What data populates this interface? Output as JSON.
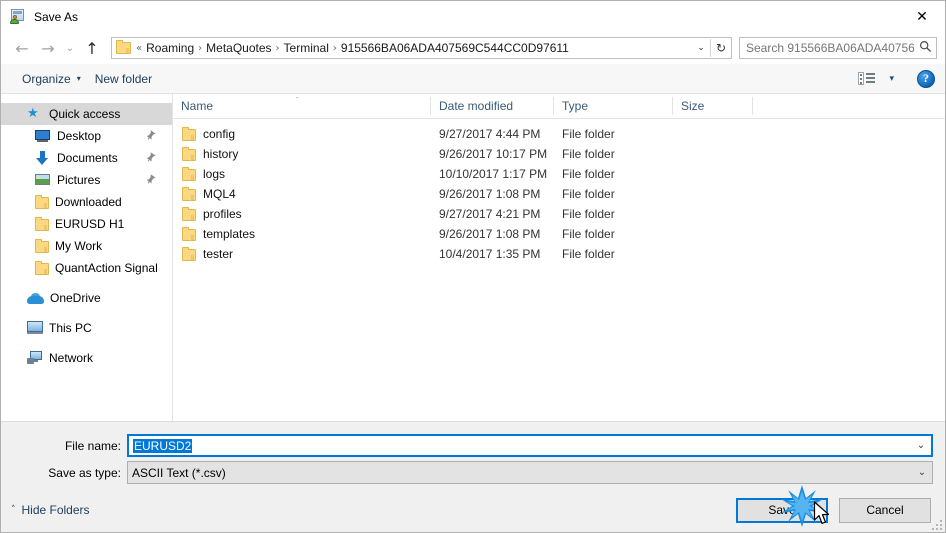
{
  "window": {
    "title": "Save As",
    "icon": "save-as-icon",
    "close_label": "✕"
  },
  "nav": {
    "back_icon": "←",
    "forward_icon": "→",
    "recent_icon": "⌄",
    "up_icon": "↑",
    "breadcrumb_prefix": "«",
    "breadcrumbs": [
      "Roaming",
      "MetaQuotes",
      "Terminal",
      "915566BA06ADA407569C544CC0D97611"
    ],
    "separator": "›",
    "dropdown_icon": "⌄",
    "refresh_icon": "↻"
  },
  "search": {
    "placeholder": "Search 915566BA06ADA40756...",
    "icon": "🔍"
  },
  "toolbar": {
    "organize_label": "Organize",
    "organize_caret": "▾",
    "new_folder_label": "New folder",
    "view_caret": "▾",
    "help_label": "?"
  },
  "sidebar": {
    "items": [
      {
        "label": "Quick access",
        "icon": "star-icon",
        "selected": true,
        "indent": false,
        "pinned": false
      },
      {
        "label": "Desktop",
        "icon": "desktop-icon",
        "selected": false,
        "indent": true,
        "pinned": true
      },
      {
        "label": "Documents",
        "icon": "documents-icon",
        "selected": false,
        "indent": true,
        "pinned": true
      },
      {
        "label": "Pictures",
        "icon": "pictures-icon",
        "selected": false,
        "indent": true,
        "pinned": true
      },
      {
        "label": "Downloaded",
        "icon": "folder-icon",
        "selected": false,
        "indent": true,
        "pinned": false
      },
      {
        "label": "EURUSD H1",
        "icon": "folder-icon",
        "selected": false,
        "indent": true,
        "pinned": false
      },
      {
        "label": "My Work",
        "icon": "folder-icon",
        "selected": false,
        "indent": true,
        "pinned": false
      },
      {
        "label": "QuantAction Signal",
        "icon": "folder-icon",
        "selected": false,
        "indent": true,
        "pinned": false
      },
      {
        "label": "OneDrive",
        "icon": "onedrive-icon",
        "selected": false,
        "indent": false,
        "pinned": false
      },
      {
        "label": "This PC",
        "icon": "this-pc-icon",
        "selected": false,
        "indent": false,
        "pinned": false
      },
      {
        "label": "Network",
        "icon": "network-icon",
        "selected": false,
        "indent": false,
        "pinned": false
      }
    ],
    "pin_glyph": "📌"
  },
  "filelist": {
    "columns": [
      "Name",
      "Date modified",
      "Type",
      "Size"
    ],
    "sort_caret": "˄",
    "rows": [
      {
        "name": "config",
        "date": "9/27/2017 4:44 PM",
        "type": "File folder",
        "size": ""
      },
      {
        "name": "history",
        "date": "9/26/2017 10:17 PM",
        "type": "File folder",
        "size": ""
      },
      {
        "name": "logs",
        "date": "10/10/2017 1:17 PM",
        "type": "File folder",
        "size": ""
      },
      {
        "name": "MQL4",
        "date": "9/26/2017 1:08 PM",
        "type": "File folder",
        "size": ""
      },
      {
        "name": "profiles",
        "date": "9/27/2017 4:21 PM",
        "type": "File folder",
        "size": ""
      },
      {
        "name": "templates",
        "date": "9/26/2017 1:08 PM",
        "type": "File folder",
        "size": ""
      },
      {
        "name": "tester",
        "date": "10/4/2017 1:35 PM",
        "type": "File folder",
        "size": ""
      }
    ]
  },
  "form": {
    "file_name_label": "File name:",
    "file_name_value": "EURUSD2",
    "save_as_type_label": "Save as type:",
    "save_as_type_value": "ASCII Text (*.csv)",
    "dropdown_icon": "⌄"
  },
  "footer": {
    "hide_folders_label": "Hide Folders",
    "hide_folders_caret": "˄",
    "save_label": "Save",
    "cancel_label": "Cancel"
  },
  "colors": {
    "accent": "#0078d7",
    "selection": "#0078d7",
    "folder": "#fbd881",
    "header_text": "#3b5a75",
    "burst": "#1a8fe3"
  }
}
